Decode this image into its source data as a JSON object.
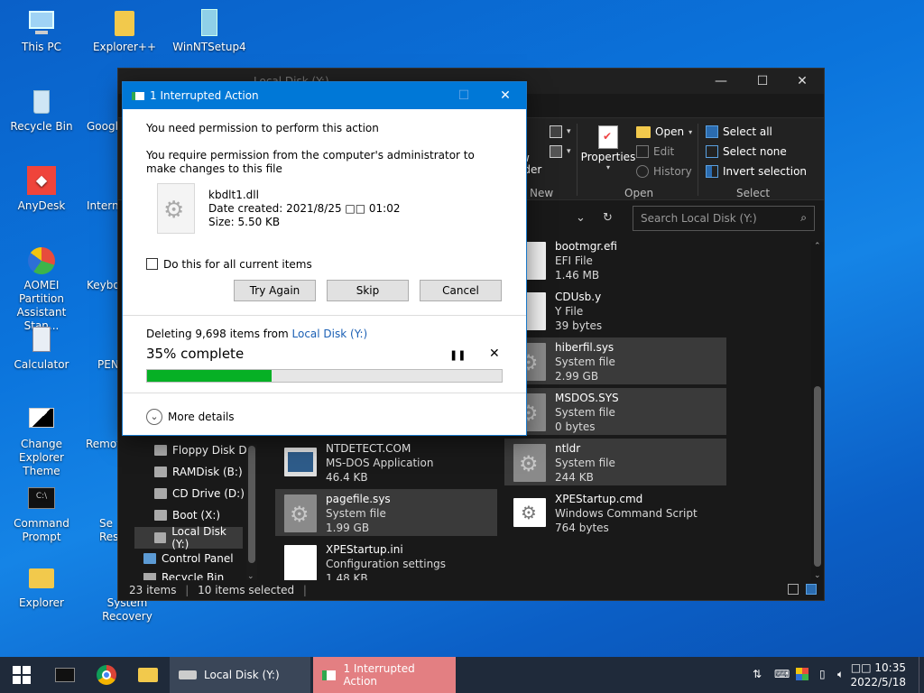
{
  "desktop": {
    "icons": [
      {
        "label": "This PC",
        "icon": "computer-icon"
      },
      {
        "label": "Explorer++",
        "icon": "folder-icon"
      },
      {
        "label": "WinNTSetup4",
        "icon": "setup-icon"
      },
      {
        "label": "Recycle Bin",
        "icon": "recycle-bin-icon"
      },
      {
        "label": "Googl",
        "icon": "chrome-icon"
      },
      {
        "label": "AnyDesk",
        "icon": "anydesk-icon"
      },
      {
        "label": "Interne",
        "icon": "internet-icon"
      },
      {
        "label": "AOMEI Partition Assistant Stan...",
        "icon": "partition-icon"
      },
      {
        "label": "Keybo",
        "icon": "keyboard-icon"
      },
      {
        "label": "Calculator",
        "icon": "calculator-icon"
      },
      {
        "label": "PEN",
        "icon": "pen-icon"
      },
      {
        "label": "Change Explorer Theme",
        "icon": "theme-icon"
      },
      {
        "label": "Remot",
        "icon": "remote-icon"
      },
      {
        "label": "Command Prompt",
        "icon": "cmd-icon"
      },
      {
        "label": "Se Res",
        "icon": "settings-icon"
      },
      {
        "label": "Explorer",
        "icon": "folder-icon"
      },
      {
        "label": "System Recovery",
        "icon": "recovery-icon"
      }
    ]
  },
  "explorer": {
    "title": "Local Disk (Y:)",
    "ribbon": {
      "new_folder_partial": "w\nlder",
      "new_group": "New",
      "properties": "Properties",
      "open": "Open",
      "edit": "Edit",
      "history": "History",
      "open_group": "Open",
      "select_all": "Select all",
      "select_none": "Select none",
      "invert_selection": "Invert selection",
      "select_group": "Select"
    },
    "search_placeholder": "Search Local Disk (Y:)",
    "nav": [
      {
        "label": "Floppy Disk Dri"
      },
      {
        "label": "RAMDisk (B:)"
      },
      {
        "label": "CD Drive (D:)"
      },
      {
        "label": "Boot (X:)"
      },
      {
        "label": "Local Disk (Y:)"
      },
      {
        "label": "Control Panel"
      },
      {
        "label": "Recycle Bin"
      }
    ],
    "files": [
      {
        "name": "bootmgr.efi",
        "type": "EFI File",
        "size": "1.46 MB"
      },
      {
        "name": "CDUsb.y",
        "type": "Y File",
        "size": "39 bytes"
      },
      {
        "name": "hiberfil.sys",
        "type": "System file",
        "size": "2.99 GB"
      },
      {
        "name": "MSDOS.SYS",
        "type": "System file",
        "size": "0 bytes"
      },
      {
        "name": "NTDETECT.COM",
        "type": "MS-DOS Application",
        "size": "46.4 KB"
      },
      {
        "name": "ntldr",
        "type": "System file",
        "size": "244 KB"
      },
      {
        "name": "pagefile.sys",
        "type": "System file",
        "size": "1.99 GB"
      },
      {
        "name": "XPEStartup.cmd",
        "type": "Windows Command Script",
        "size": "764 bytes"
      },
      {
        "name": "XPEStartup.ini",
        "type": "Configuration settings",
        "size": "1.48 KB"
      }
    ],
    "status": {
      "items": "23 items",
      "selected": "10 items selected"
    }
  },
  "dialog": {
    "title": "1 Interrupted Action",
    "heading": "You need permission to perform this action",
    "message": "You require permission from the computer's administrator to make changes to this file",
    "file": {
      "name": "kbdlt1.dll",
      "date_created": "Date created: 2021/8/25 □□ 01:02",
      "size": "Size: 5.50 KB"
    },
    "checkbox_label": "Do this for all current items",
    "buttons": {
      "try_again": "Try Again",
      "skip": "Skip",
      "cancel": "Cancel"
    },
    "progress": {
      "deleting_prefix": "Deleting 9,698 items from ",
      "location": "Local Disk (Y:)",
      "percent_text": "35% complete",
      "percent": 35
    },
    "more_details": "More details"
  },
  "taskbar": {
    "items": [
      {
        "label": "Local Disk (Y:)"
      },
      {
        "label": "1 Interrupted Action"
      }
    ],
    "clock": {
      "time": "□□ 10:35",
      "date": "2022/5/18"
    }
  }
}
